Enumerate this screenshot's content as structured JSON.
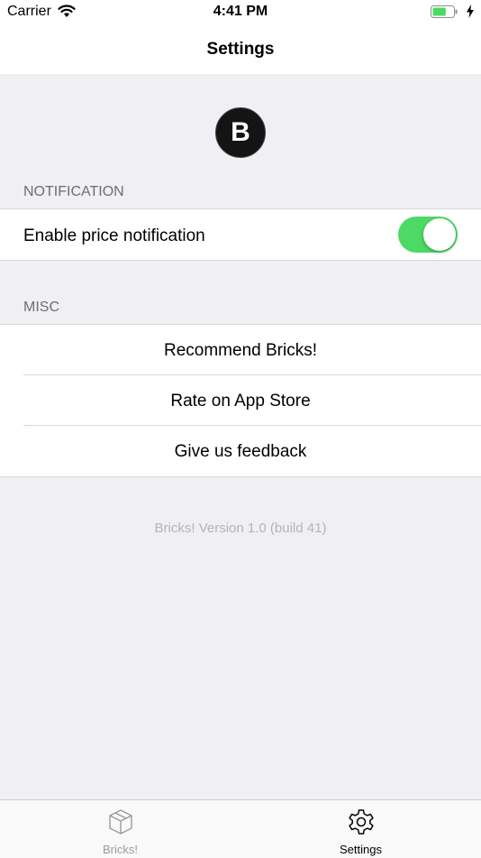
{
  "status_bar": {
    "carrier": "Carrier",
    "time": "4:41 PM",
    "battery_level": 0.65,
    "battery_color": "#4cd964"
  },
  "nav": {
    "title": "Settings"
  },
  "header_logo": {
    "letter": "B"
  },
  "sections": {
    "notification": {
      "header": "NOTIFICATION",
      "items": [
        {
          "label": "Enable price notification",
          "toggle_on": true,
          "toggle_color": "#4cd964"
        }
      ]
    },
    "misc": {
      "header": "MISC",
      "items": [
        {
          "label": "Recommend Bricks!"
        },
        {
          "label": "Rate on App Store"
        },
        {
          "label": "Give us feedback"
        }
      ]
    }
  },
  "footer": {
    "version": "Bricks! Version 1.0 (build 41)"
  },
  "tab_bar": {
    "tabs": [
      {
        "label": "Bricks!",
        "icon": "cube-icon",
        "active": false
      },
      {
        "label": "Settings",
        "icon": "gear-icon",
        "active": true
      }
    ],
    "active_color": "#000000",
    "inactive_color": "#9b9b9b"
  }
}
